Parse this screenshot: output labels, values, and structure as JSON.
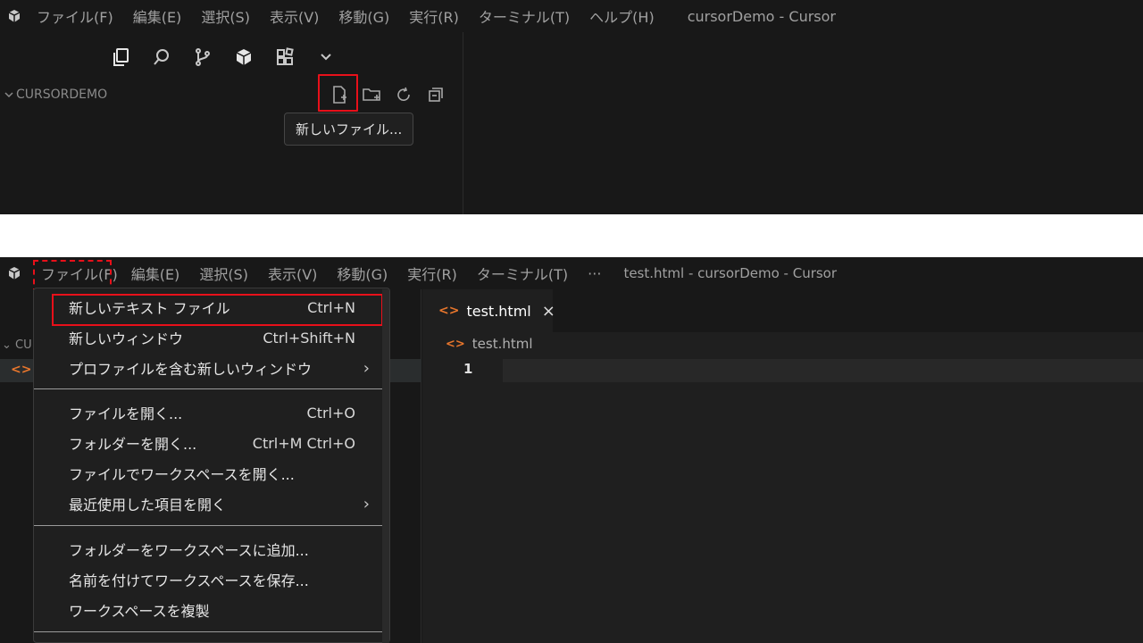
{
  "top": {
    "menu": [
      "ファイル(F)",
      "編集(E)",
      "選択(S)",
      "表示(V)",
      "移動(G)",
      "実行(R)",
      "ターミナル(T)",
      "ヘルプ(H)"
    ],
    "window_title": "cursorDemo - Cursor",
    "explorer_title": "CURSORDEMO",
    "tooltip": "新しいファイル...",
    "activity_icons": [
      "files-icon",
      "search-icon",
      "source-control-icon",
      "extensions-icon",
      "extensions-grid-icon",
      "chevron-down-icon"
    ],
    "explorer_actions": [
      "new-file-icon",
      "new-folder-icon",
      "refresh-icon",
      "collapse-all-icon"
    ]
  },
  "bottom": {
    "menu": [
      "ファイル(F)",
      "編集(E)",
      "選択(S)",
      "表示(V)",
      "移動(G)",
      "実行(R)",
      "ターミナル(T)",
      "···"
    ],
    "window_title": "test.html - cursorDemo - Cursor",
    "explorer_label": "CU",
    "tab": {
      "label": "test.html",
      "close": "×"
    },
    "breadcrumb": "test.html",
    "line_number": "1",
    "file_menu": {
      "items": [
        {
          "label": "新しいテキスト ファイル",
          "shortcut": "Ctrl+N"
        },
        {
          "label": "新しいウィンドウ",
          "shortcut": "Ctrl+Shift+N"
        },
        {
          "label": "プロファイルを含む新しいウィンドウ",
          "submenu": "›"
        },
        {
          "label": "ファイルを開く...",
          "shortcut": "Ctrl+O"
        },
        {
          "label": "フォルダーを開く...",
          "shortcut": "Ctrl+M Ctrl+O"
        },
        {
          "label": "ファイルでワークスペースを開く..."
        },
        {
          "label": "最近使用した項目を開く",
          "submenu": "›"
        },
        {
          "label": "フォルダーをワークスペースに追加..."
        },
        {
          "label": "名前を付けてワークスペースを保存..."
        },
        {
          "label": "ワークスペースを複製"
        }
      ]
    }
  },
  "colors": {
    "highlight": "#e8101a",
    "html_icon": "#e8762c",
    "background": "#181818"
  }
}
